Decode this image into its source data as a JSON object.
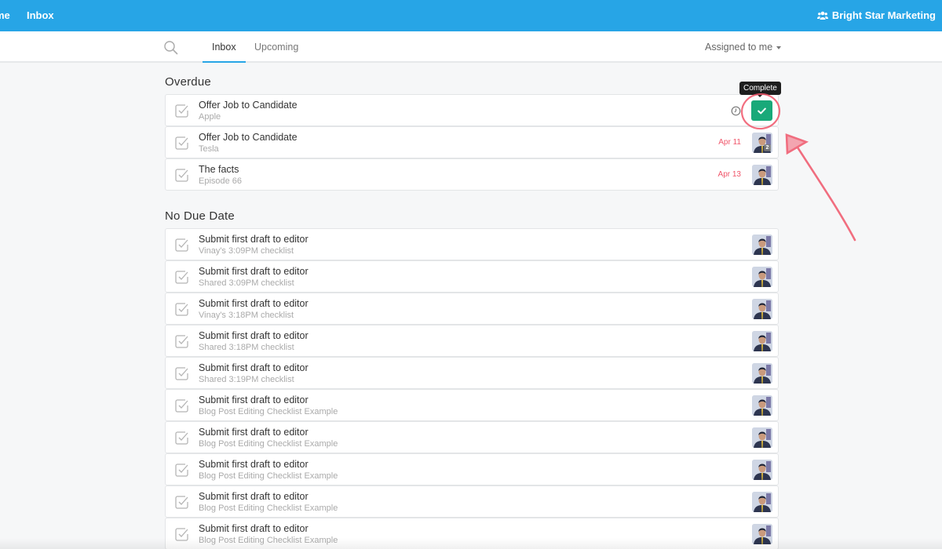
{
  "topbar": {
    "nav": [
      {
        "label": "Home",
        "visible_text": "me"
      },
      {
        "label": "Inbox"
      }
    ],
    "organization": "Bright Star Marketing",
    "org_icon": "users-icon",
    "color": "#27a5e6"
  },
  "subbar": {
    "search_icon": "search-icon",
    "tabs": [
      {
        "label": "Inbox",
        "active": true
      },
      {
        "label": "Upcoming",
        "active": false
      }
    ],
    "filter": {
      "label": "Assigned to me"
    }
  },
  "sections": [
    {
      "title": "Overdue",
      "items": [
        {
          "title": "Offer Job to Candidate",
          "subtitle": "Apple",
          "due": "",
          "hover": true
        },
        {
          "title": "Offer Job to Candidate",
          "subtitle": "Tesla",
          "due": "Apr 11",
          "assignee_count": "2"
        },
        {
          "title": "The facts",
          "subtitle": "Episode 66",
          "due": "Apr 13"
        }
      ]
    },
    {
      "title": "No Due Date",
      "items": [
        {
          "title": "Submit first draft to editor",
          "subtitle": "Vinay's 3:09PM checklist"
        },
        {
          "title": "Submit first draft to editor",
          "subtitle": "Shared 3:09PM checklist"
        },
        {
          "title": "Submit first draft to editor",
          "subtitle": "Vinay's 3:18PM checklist"
        },
        {
          "title": "Submit first draft to editor",
          "subtitle": "Shared 3:18PM checklist"
        },
        {
          "title": "Submit first draft to editor",
          "subtitle": "Shared 3:19PM checklist"
        },
        {
          "title": "Submit first draft to editor",
          "subtitle": "Blog Post Editing Checklist Example"
        },
        {
          "title": "Submit first draft to editor",
          "subtitle": "Blog Post Editing Checklist Example"
        },
        {
          "title": "Submit first draft to editor",
          "subtitle": "Blog Post Editing Checklist Example"
        },
        {
          "title": "Submit first draft to editor",
          "subtitle": "Blog Post Editing Checklist Example"
        },
        {
          "title": "Submit first draft to editor",
          "subtitle": "Blog Post Editing Checklist Example"
        }
      ]
    }
  ],
  "tooltip": {
    "label": "Complete"
  },
  "colors": {
    "accent": "#27a5e6",
    "complete": "#19a979",
    "overdue": "#f0566a",
    "annotation": "#f0566a"
  }
}
